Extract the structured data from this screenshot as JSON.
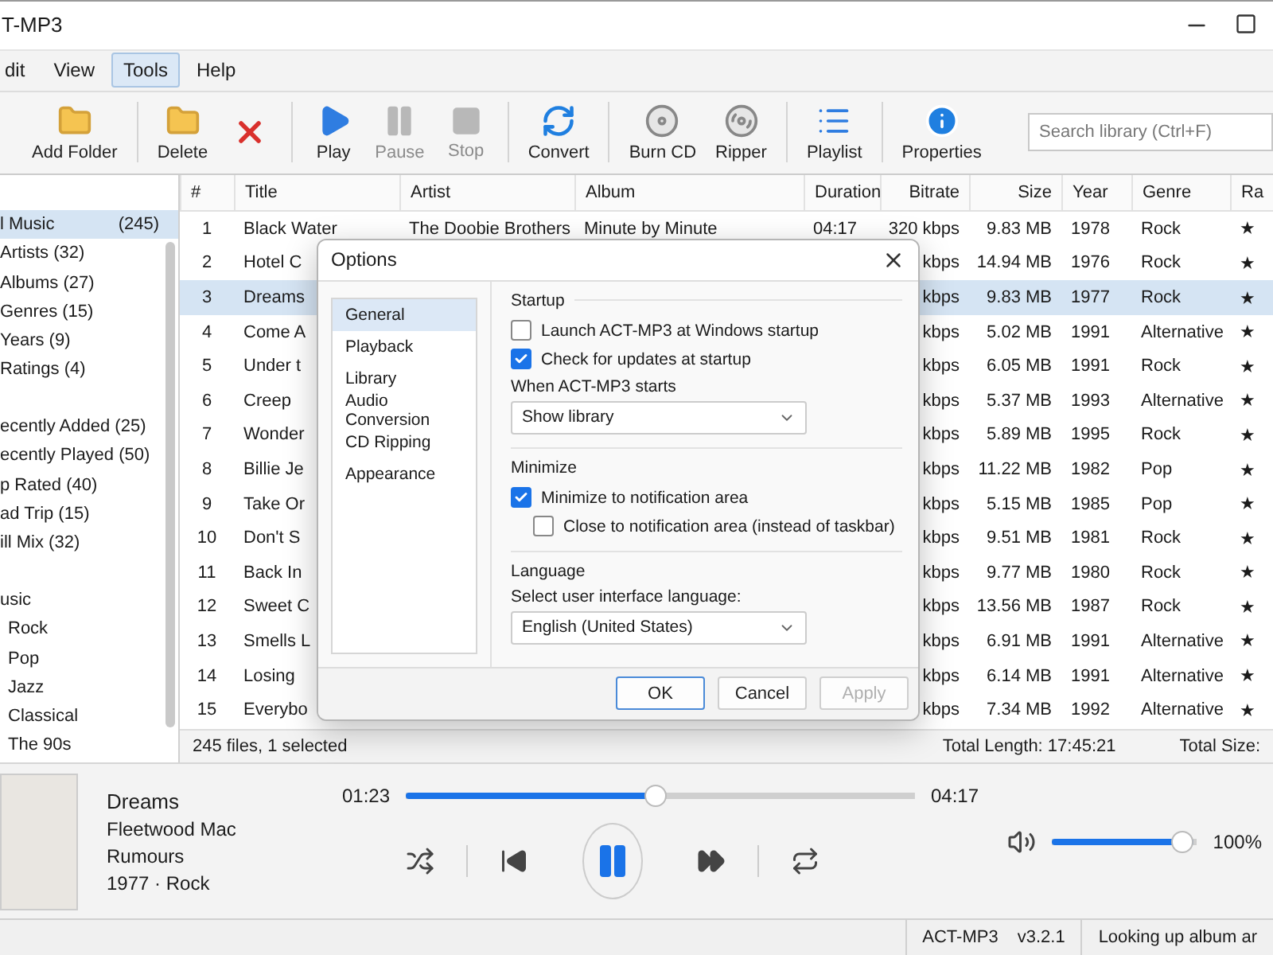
{
  "window": {
    "title": "T-MP3"
  },
  "menu": [
    {
      "label": "dit",
      "selected": false
    },
    {
      "label": "View",
      "selected": false
    },
    {
      "label": "Tools",
      "selected": true
    },
    {
      "label": "Help",
      "selected": false
    }
  ],
  "toolbar": [
    {
      "kind": "button",
      "label": "Add Folder",
      "disabled": false
    },
    {
      "kind": "separator"
    },
    {
      "kind": "button",
      "label": "Delete",
      "disabled": false
    },
    {
      "kind": "button",
      "disabled": false
    },
    {
      "kind": "separator"
    },
    {
      "kind": "button",
      "label": "Play",
      "disabled": false
    },
    {
      "kind": "button",
      "label": "Pause",
      "disabled": true
    },
    {
      "kind": "button",
      "label": "Stop",
      "disabled": true
    },
    {
      "kind": "separator"
    },
    {
      "kind": "button",
      "label": "Convert",
      "disabled": false
    },
    {
      "kind": "separator"
    },
    {
      "kind": "button",
      "label": "Burn CD",
      "disabled": false
    },
    {
      "kind": "button",
      "label": "Ripper",
      "disabled": false
    },
    {
      "kind": "separator"
    },
    {
      "kind": "button",
      "label": "Playlist",
      "disabled": false
    },
    {
      "kind": "separator"
    },
    {
      "kind": "button",
      "label": "Properties",
      "disabled": false
    }
  ],
  "search": {
    "placeholder": "Search library (Ctrl+F)"
  },
  "sidebar": {
    "sections": [
      {
        "items": [
          {
            "label": "l Music",
            "count": "(245)",
            "selected": true
          },
          {
            "label": "Artists (32)",
            "selected": false
          },
          {
            "label": "Albums (27)",
            "selected": false
          },
          {
            "label": "Genres (15)",
            "selected": false
          },
          {
            "label": "Years (9)",
            "selected": false
          },
          {
            "label": "Ratings (4)",
            "selected": false
          }
        ]
      },
      {
        "items": [
          {
            "label": "ecently Added (25)",
            "selected": false
          },
          {
            "label": "ecently Played (50)",
            "selected": false
          },
          {
            "label": "p Rated (40)",
            "selected": false
          },
          {
            "label": "ad Trip (15)",
            "selected": false
          },
          {
            "label": "ill Mix (32)",
            "selected": false
          }
        ]
      },
      {
        "items": [
          {
            "label": "usic",
            "selected": false,
            "children": [
              {
                "label": "Rock",
                "selected": false
              },
              {
                "label": "Pop",
                "selected": false
              },
              {
                "label": "Jazz",
                "selected": false
              },
              {
                "label": "Classical",
                "selected": false
              },
              {
                "label": "The 90s",
                "selected": false
              }
            ]
          }
        ]
      }
    ]
  },
  "table": {
    "columns": [
      "#",
      "Title",
      "Artist",
      "Album",
      "Duration",
      "Bitrate",
      "Size",
      "Year",
      "Genre",
      "Ra"
    ],
    "rows": [
      {
        "num": "1",
        "title": "Black Water",
        "artist": "The Doobie Brothers",
        "album": "Minute by Minute",
        "duration": "04:17",
        "bitrate": "320 kbps",
        "size": "9.83 MB",
        "year": "1978",
        "genre": "Rock",
        "rating": "★",
        "selected": false
      },
      {
        "num": "2",
        "title": "Hotel C",
        "bitrate": "kbps",
        "size": "14.94 MB",
        "year": "1976",
        "genre": "Rock",
        "rating": "★",
        "selected": false
      },
      {
        "num": "3",
        "title": "Dreams",
        "bitrate": "kbps",
        "size": "9.83 MB",
        "year": "1977",
        "genre": "Rock",
        "rating": "★",
        "selected": true
      },
      {
        "num": "4",
        "title": "Come A",
        "bitrate": "kbps",
        "size": "5.02 MB",
        "year": "1991",
        "genre": "Alternative",
        "rating": "★",
        "selected": false
      },
      {
        "num": "5",
        "title": "Under t",
        "bitrate": "kbps",
        "size": "6.05 MB",
        "year": "1991",
        "genre": "Rock",
        "rating": "★",
        "selected": false
      },
      {
        "num": "6",
        "title": "Creep",
        "bitrate": "kbps",
        "size": "5.37 MB",
        "year": "1993",
        "genre": "Alternative",
        "rating": "★",
        "selected": false
      },
      {
        "num": "7",
        "title": "Wonder",
        "bitrate": "kbps",
        "size": "5.89 MB",
        "year": "1995",
        "genre": "Rock",
        "rating": "★",
        "selected": false
      },
      {
        "num": "8",
        "title": "Billie Je",
        "bitrate": "kbps",
        "size": "11.22 MB",
        "year": "1982",
        "genre": "Pop",
        "rating": "★",
        "selected": false
      },
      {
        "num": "9",
        "title": "Take Or",
        "bitrate": "kbps",
        "size": "5.15 MB",
        "year": "1985",
        "genre": "Pop",
        "rating": "★",
        "selected": false
      },
      {
        "num": "10",
        "title": "Don't S",
        "bitrate": "kbps",
        "size": "9.51 MB",
        "year": "1981",
        "genre": "Rock",
        "rating": "★",
        "selected": false
      },
      {
        "num": "11",
        "title": "Back In",
        "bitrate": "kbps",
        "size": "9.77 MB",
        "year": "1980",
        "genre": "Rock",
        "rating": "★",
        "selected": false
      },
      {
        "num": "12",
        "title": "Sweet C",
        "bitrate": "kbps",
        "size": "13.56 MB",
        "year": "1987",
        "genre": "Rock",
        "rating": "★",
        "selected": false
      },
      {
        "num": "13",
        "title": "Smells L",
        "bitrate": "kbps",
        "size": "6.91 MB",
        "year": "1991",
        "genre": "Alternative",
        "rating": "★",
        "selected": false
      },
      {
        "num": "14",
        "title": "Losing",
        "bitrate": "kbps",
        "size": "6.14 MB",
        "year": "1991",
        "genre": "Alternative",
        "rating": "★",
        "selected": false
      },
      {
        "num": "15",
        "title": "Everybo",
        "bitrate": "kbps",
        "size": "7.34 MB",
        "year": "1992",
        "genre": "Alternative",
        "rating": "★",
        "selected": false
      }
    ]
  },
  "table_status": {
    "files": "245 files, 1 selected",
    "length": "Total Length: 17:45:21",
    "size": "Total Size:"
  },
  "player": {
    "title": "Dreams",
    "artist": "Fleetwood Mac",
    "album": "Rumours",
    "year": "1977",
    "separator": "·",
    "genre": "Rock",
    "elapsed": "01:23",
    "total": "04:17",
    "level": 0.49,
    "playing": true,
    "volume": {
      "level": 0.97,
      "reading": "100%"
    }
  },
  "status_bar": {
    "app": "ACT-MP3",
    "version": "v3.2.1",
    "message": "Looking up album ar"
  },
  "dialog": {
    "title": "Options",
    "nav": [
      {
        "label": "General",
        "selected": true
      },
      {
        "label": "Playback",
        "selected": false
      },
      {
        "label": "Library",
        "selected": false
      },
      {
        "label": "Audio Conversion",
        "selected": false
      },
      {
        "label": "CD Ripping",
        "selected": false
      },
      {
        "label": "Appearance",
        "selected": false
      }
    ],
    "sections": [
      {
        "heading": "Startup",
        "controls": [
          {
            "kind": "checkbox",
            "label": "Launch ACT-MP3 at Windows startup",
            "checked": false
          },
          {
            "kind": "checkbox",
            "label": "Check for updates at startup",
            "checked": true
          },
          {
            "kind": "select",
            "label": "When ACT-MP3 starts",
            "value": "Show library"
          }
        ]
      },
      {
        "heading": "Minimize",
        "controls": [
          {
            "kind": "checkbox",
            "label": "Minimize to notification area",
            "checked": true,
            "children": [
              {
                "kind": "checkbox",
                "label": "Close to notification area (instead of taskbar)",
                "checked": false
              }
            ]
          }
        ]
      },
      {
        "heading": "Language",
        "controls": [
          {
            "kind": "select",
            "label": "Select user interface language:",
            "value": "English (United States)"
          }
        ]
      }
    ],
    "buttons": [
      {
        "label": "OK",
        "default": true,
        "disabled": false
      },
      {
        "label": "Cancel",
        "default": false,
        "disabled": false
      },
      {
        "label": "Apply",
        "default": false,
        "disabled": true
      }
    ]
  }
}
